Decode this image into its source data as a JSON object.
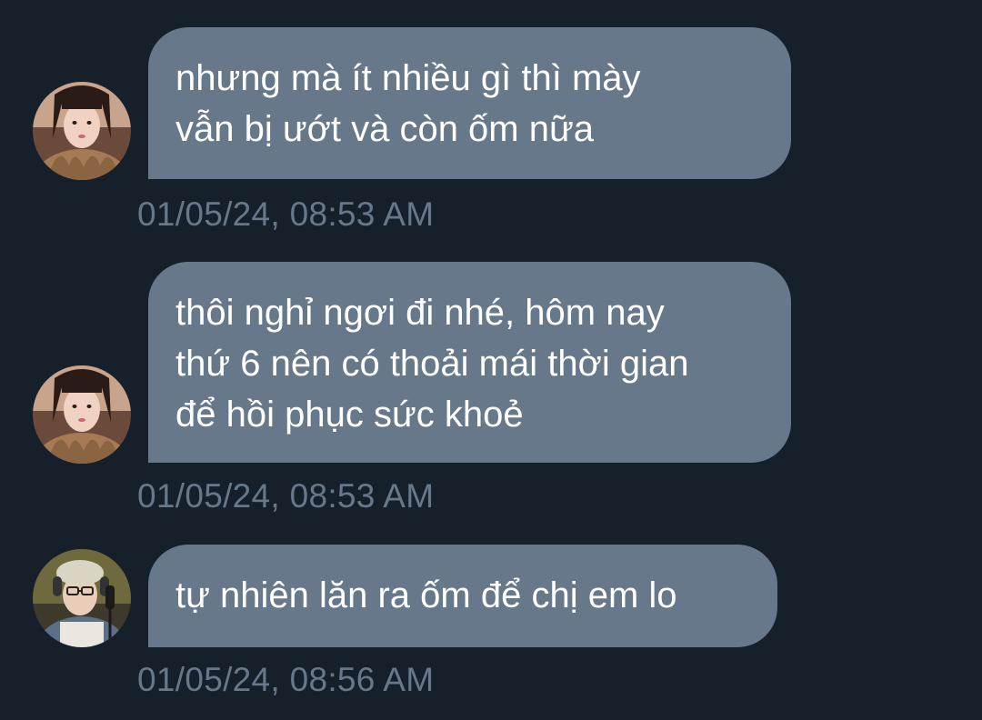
{
  "messages": [
    {
      "sender": "contact",
      "lines": [
        "nhưng mà ít nhiều gì thì mày",
        "vẫn bị ướt và còn ốm nữa"
      ],
      "timestamp": "01/05/24, 08:53 AM"
    },
    {
      "sender": "contact",
      "lines": [
        "thôi nghỉ ngơi đi nhé, hôm nay",
        "thứ 6 nên có thoải mái thời gian",
        "để hồi phục sức khoẻ"
      ],
      "timestamp": "01/05/24, 08:53 AM"
    },
    {
      "sender": "other-contact",
      "lines": [
        "tự nhiên lăn ra ốm để chị em lo"
      ],
      "timestamp": "01/05/24, 08:56 AM"
    }
  ],
  "colors": {
    "background": "#16202a",
    "bubble": "#66788a",
    "bubble_text": "#ffffff",
    "timestamp": "#66788a"
  }
}
